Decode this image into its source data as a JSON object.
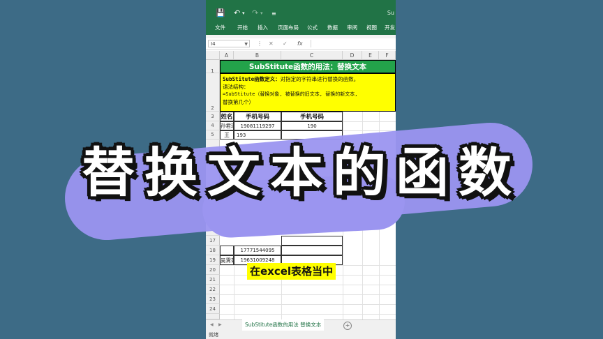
{
  "app": {
    "ribbon_tabs": [
      "文件",
      "开始",
      "插入",
      "页面布局",
      "公式",
      "数据",
      "审阅",
      "视图",
      "开发"
    ],
    "title_fragment": "Su"
  },
  "formula_bar": {
    "cell_ref": "I4",
    "fx": "fx",
    "cancel": "✕",
    "confirm": "✓"
  },
  "columns": [
    "A",
    "B",
    "C",
    "D",
    "E",
    "F"
  ],
  "rows": [
    "1",
    "2",
    "3",
    "4",
    "5",
    "",
    "",
    "",
    "",
    "",
    "",
    "",
    "",
    "",
    "",
    "",
    "17",
    "18",
    "19",
    "20",
    "21",
    "22",
    "23",
    "24"
  ],
  "sheet": {
    "title": "SubStitute函数的用法：替换文本",
    "definition_label": "SubStitute函数定义：",
    "definition_text": "对指定的字符串进行替换的函数。",
    "syntax_label": "语法结构：",
    "syntax_formula": "=SubStitute（替换对象, 被替换的旧文本, 替换的新文本,",
    "syntax_tail": "替换第几个）",
    "table_headers": [
      "姓名",
      "手机号码",
      "手机号码"
    ],
    "table_rows": [
      {
        "name": "孙君琪",
        "phone": "19081119297",
        "result": "190"
      },
      {
        "name": "王",
        "phone": "193",
        "result": ""
      },
      {
        "name": "",
        "phone": "17771544095",
        "result": ""
      },
      {
        "name": "吴霄菁",
        "phone": "19631009248",
        "result": ""
      }
    ]
  },
  "sheet_tab": "SubStitute函数的用法 替换文本",
  "status": "就绪",
  "overlay": {
    "headline": "替换文本的函数",
    "subtitle": "在excel表格当中"
  }
}
